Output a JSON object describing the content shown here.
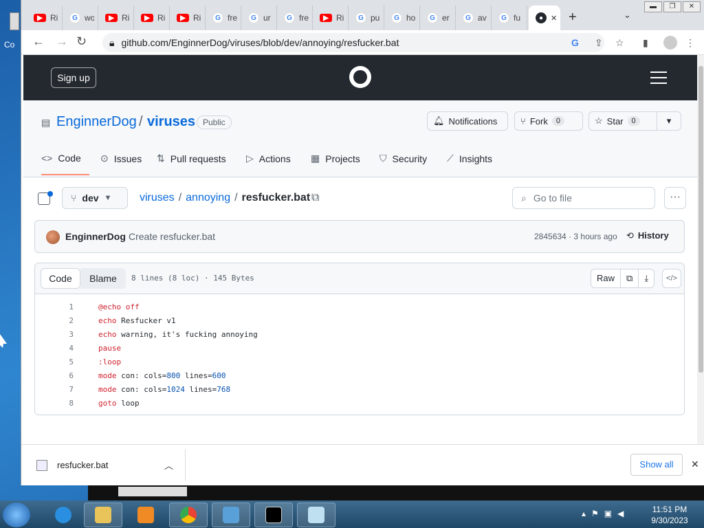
{
  "desktop": {
    "icon_label": "Co"
  },
  "tabs": [
    {
      "icon": "youtube-icon",
      "label": "Ri"
    },
    {
      "icon": "google-icon",
      "label": "wo"
    },
    {
      "icon": "youtube-icon",
      "label": "Ri"
    },
    {
      "icon": "youtube-icon",
      "label": "Ri"
    },
    {
      "icon": "youtube-icon",
      "label": "Ri"
    },
    {
      "icon": "google-icon",
      "label": "fre"
    },
    {
      "icon": "google-icon",
      "label": "ur"
    },
    {
      "icon": "google-icon",
      "label": "fre"
    },
    {
      "icon": "youtube-icon",
      "label": "Ri"
    },
    {
      "icon": "google-icon",
      "label": "pu"
    },
    {
      "icon": "google-icon",
      "label": "ho"
    },
    {
      "icon": "google-icon",
      "label": "er"
    },
    {
      "icon": "google-icon",
      "label": "av"
    },
    {
      "icon": "google-icon",
      "label": "fu"
    }
  ],
  "active_tab": {
    "icon": "github-icon",
    "close": "✕"
  },
  "newtab": "+",
  "tablist": "⌄",
  "address": "github.com/EnginnerDog/viruses/blob/dev/annoying/resfucker.bat",
  "gh": {
    "signup": "Sign up"
  },
  "repo": {
    "owner": "EnginnerDog",
    "slash": "/",
    "name": "viruses",
    "visibility": "Public",
    "notifications": "Notifications",
    "fork": "Fork",
    "fork_count": "0",
    "star": "Star",
    "star_count": "0"
  },
  "repo_tabs": [
    {
      "icon": "<>",
      "label": "Code"
    },
    {
      "icon": "⊙",
      "label": "Issues"
    },
    {
      "icon": "⇅",
      "label": "Pull requests"
    },
    {
      "icon": "▷",
      "label": "Actions"
    },
    {
      "icon": "▦",
      "label": "Projects"
    },
    {
      "icon": "⛉",
      "label": "Security"
    },
    {
      "icon": "⟋",
      "label": "Insights"
    }
  ],
  "file": {
    "branch": "dev",
    "crumb_repo": "viruses",
    "crumb_dir": "annoying",
    "crumb_file": "resfucker.bat",
    "sep": "/",
    "goto_placeholder": "Go to file",
    "more": "···"
  },
  "commit": {
    "author": "EnginnerDog",
    "message": "Create resfucker.bat",
    "sha_time": "2845634 · 3 hours ago",
    "history": "History"
  },
  "viewer": {
    "code_tab": "Code",
    "blame_tab": "Blame",
    "info": "8 lines (8 loc) · 145 Bytes",
    "raw": "Raw"
  },
  "code_lines": [
    {
      "n": "1",
      "parts": [
        [
          "kw",
          "@echo off"
        ]
      ]
    },
    {
      "n": "2",
      "parts": [
        [
          "kw",
          "echo"
        ],
        [
          "",
          "Resfucker v1"
        ]
      ]
    },
    {
      "n": "3",
      "parts": [
        [
          "kw",
          "echo"
        ],
        [
          "",
          "warning, it's fucking annoying"
        ]
      ]
    },
    {
      "n": "4",
      "parts": [
        [
          "kw",
          "pause"
        ]
      ]
    },
    {
      "n": "5",
      "parts": [
        [
          "kw",
          ":loop"
        ]
      ]
    },
    {
      "n": "6",
      "parts": [
        [
          "kw",
          "mode"
        ],
        [
          "",
          "con: cols="
        ],
        [
          "num",
          "800"
        ],
        [
          "",
          " lines="
        ],
        [
          "num",
          "600"
        ]
      ]
    },
    {
      "n": "7",
      "parts": [
        [
          "kw",
          "mode"
        ],
        [
          "",
          "con: cols="
        ],
        [
          "num",
          "1024"
        ],
        [
          "",
          " lines="
        ],
        [
          "num",
          "768"
        ]
      ]
    },
    {
      "n": "8",
      "parts": [
        [
          "kw",
          "goto"
        ],
        [
          "",
          "loop"
        ]
      ]
    }
  ],
  "download": {
    "filename": "resfucker.bat",
    "show_all": "Show all"
  },
  "clock": {
    "time": "11:51 PM",
    "date": "9/30/2023"
  }
}
